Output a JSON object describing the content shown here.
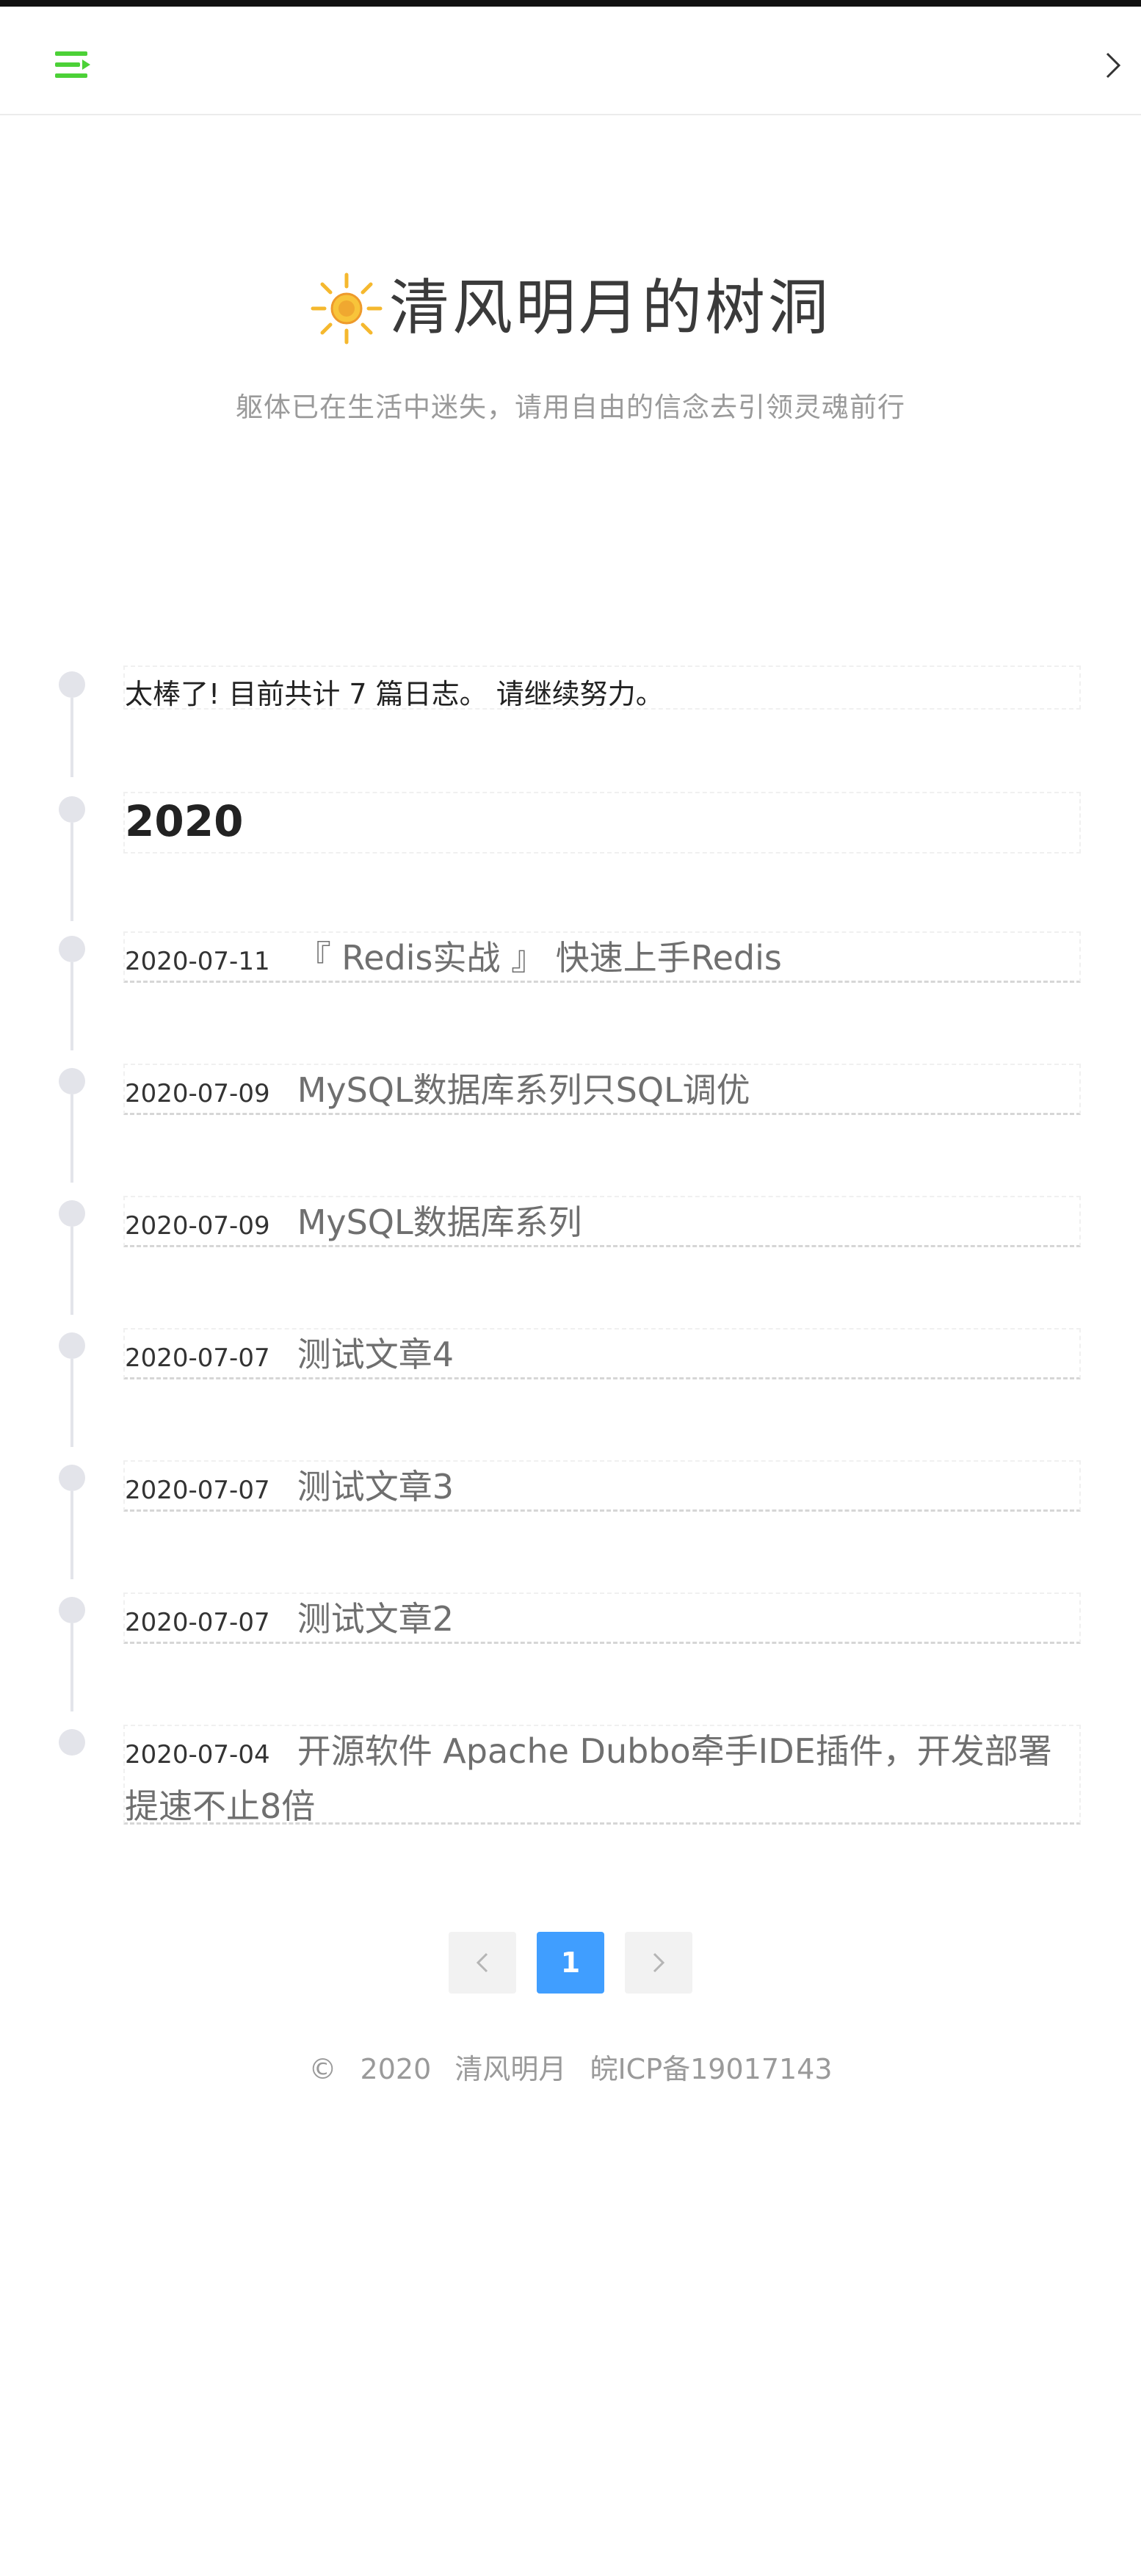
{
  "colors": {
    "accent_green": "#4cd137",
    "pager_active": "#409eff",
    "sun": "#f5b82e"
  },
  "header": {
    "menu_icon": "menu-list-icon",
    "expand_icon": "chevron-right-icon"
  },
  "brand": {
    "icon": "sun-icon",
    "title": "清风明月的树洞",
    "subtitle": "躯体已在生活中迷失，请用自由的信念去引领灵魂前行"
  },
  "timeline": {
    "summary": "太棒了! 目前共计 7 篇日志。 请继续努力。",
    "year": "2020",
    "posts": [
      {
        "date": "2020-07-11",
        "title": "『 Redis实战 』 快速上手Redis"
      },
      {
        "date": "2020-07-09",
        "title": "MySQL数据库系列只SQL调优"
      },
      {
        "date": "2020-07-09",
        "title": "MySQL数据库系列"
      },
      {
        "date": "2020-07-07",
        "title": "测试文章4"
      },
      {
        "date": "2020-07-07",
        "title": "测试文章3"
      },
      {
        "date": "2020-07-07",
        "title": "测试文章2"
      },
      {
        "date": "2020-07-04",
        "title": "开源软件 Apache Dubbo牵手IDE插件，开发部署提速不止8倍"
      }
    ]
  },
  "pagination": {
    "prev_icon": "chevron-left-icon",
    "current_page": "1",
    "next_icon": "chevron-right-icon"
  },
  "footer": {
    "copyright_symbol": "©",
    "year": "2020",
    "owner": "清风明月",
    "icp": "皖ICP备19017143"
  }
}
